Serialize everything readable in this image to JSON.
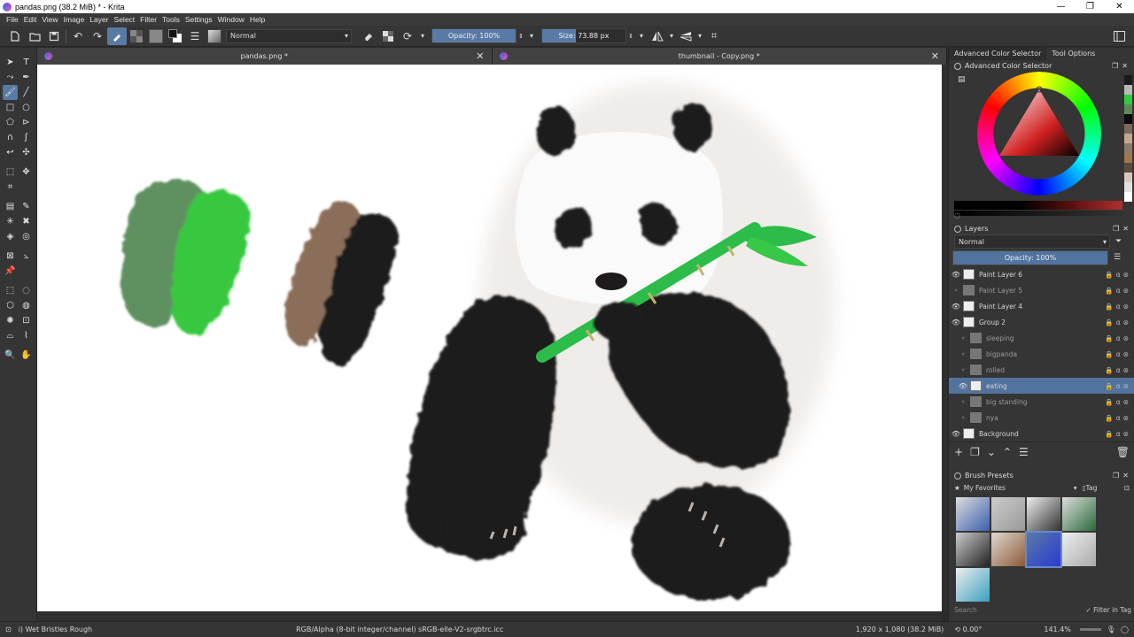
{
  "window": {
    "title": "pandas.png  (38.2 MiB)  * - Krita",
    "minimize": "—",
    "maximize": "❐",
    "close": "✕"
  },
  "menu": [
    "File",
    "Edit",
    "View",
    "Image",
    "Layer",
    "Select",
    "Filter",
    "Tools",
    "Settings",
    "Window",
    "Help"
  ],
  "toolbar": {
    "blend_mode": "Normal",
    "opacity": "Opacity: 100%",
    "opacity_fraction": 1.0,
    "size": "Size: 73.88 px",
    "size_fraction": 0.4
  },
  "tabs": [
    {
      "label": "pandas.png *"
    },
    {
      "label": "thumbnail - Copy.png *"
    }
  ],
  "dock": {
    "tabs": [
      "Advanced Color Selector",
      "Tool Options"
    ],
    "color_selector_title": "Advanced Color Selector",
    "palette_colors": [
      "#1a1a1a",
      "#b8b8b8",
      "#2ecc40",
      "#5a8c5a",
      "#0a0a0a",
      "#7a6a5a",
      "#c4a890",
      "#8c7a6a",
      "#a07850",
      "#5c4a3a",
      "#d8c8b8",
      "#e0e0e0",
      "#ffffff"
    ],
    "layers_title": "Layers",
    "layers_blend": "Normal",
    "layers_opacity": "Opacity:  100%",
    "layers": [
      {
        "name": "Paint Layer 6",
        "visible": true,
        "indent": 0
      },
      {
        "name": "Paint Layer 5",
        "visible": false,
        "indent": 0
      },
      {
        "name": "Paint Layer 4",
        "visible": true,
        "indent": 0
      },
      {
        "name": "Group 2",
        "visible": true,
        "indent": 0
      },
      {
        "name": "sleeping",
        "visible": false,
        "indent": 1
      },
      {
        "name": "bigpanda",
        "visible": false,
        "indent": 1
      },
      {
        "name": "rolled",
        "visible": false,
        "indent": 1
      },
      {
        "name": "eating",
        "visible": true,
        "indent": 1,
        "selected": true
      },
      {
        "name": "big standing",
        "visible": false,
        "indent": 1
      },
      {
        "name": "nya",
        "visible": false,
        "indent": 1
      },
      {
        "name": "Background",
        "visible": true,
        "indent": 0
      }
    ],
    "brush_presets_title": "Brush Presets",
    "brush_tag": "My Favorites",
    "tag_label": "Tag",
    "search_placeholder": "Search",
    "filter_in_tag": "Filter in Tag"
  },
  "status": {
    "brush": "Wet Bristles Rough",
    "color_profile": "RGB/Alpha (8-bit integer/channel)  sRGB-elle-V2-srgbtrc.icc",
    "dimensions": "1,920 x 1,080 (38.2 MiB)",
    "rotation": "0.00°",
    "zoom": "141.4%"
  }
}
